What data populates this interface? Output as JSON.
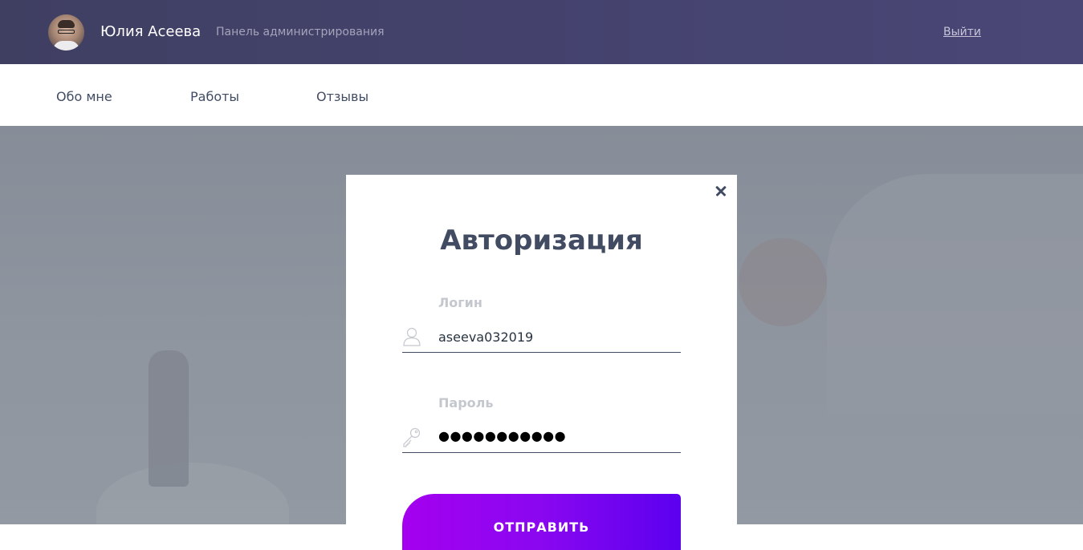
{
  "header": {
    "user_name": "Юлия Асеева",
    "panel_title": "Панель администрирования",
    "logout_label": "Выйти",
    "avatar_icon": "avatar-photo"
  },
  "nav": {
    "items": [
      {
        "label": "Обо мне"
      },
      {
        "label": "Работы"
      },
      {
        "label": "Отзывы"
      }
    ]
  },
  "modal": {
    "title": "Авторизация",
    "close_icon": "close-icon",
    "login": {
      "label": "Логин",
      "value": "aseeva032019",
      "icon": "user-icon"
    },
    "password": {
      "label": "Пароль",
      "masked_value": "●●●●●●●●●●●",
      "icon": "key-icon"
    },
    "submit_label": "ОТПРАВИТЬ"
  },
  "colors": {
    "header_bg": "#45436f",
    "text_dark": "#414c63",
    "label_muted": "#c4c8ce",
    "button_start": "#a400ef",
    "button_end": "#5b00ef"
  }
}
